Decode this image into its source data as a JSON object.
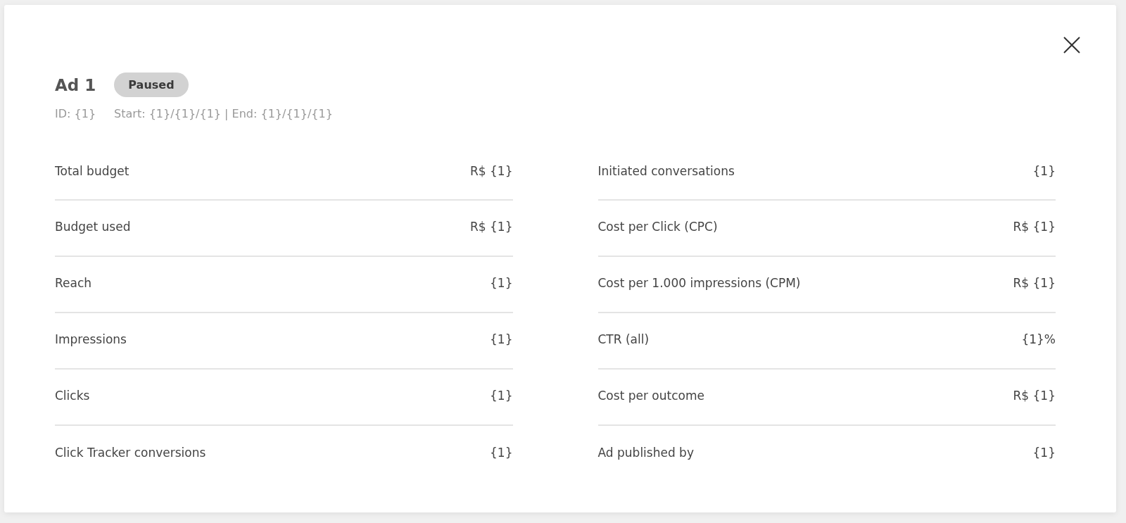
{
  "ad": {
    "title": "Ad 1",
    "status": {
      "label": "Paused",
      "kind": "paused"
    },
    "id": "ID: {1}",
    "dates": "Start: {1}/{1}/{1} | End: {1}/{1}/{1}"
  },
  "columns": [
    [
      {
        "label": "Total budget",
        "value": "R$ {1}"
      },
      {
        "label": "Budget used",
        "value": "R$ {1}"
      },
      {
        "label": "Reach",
        "value": "{1}"
      },
      {
        "label": "Impressions",
        "value": "{1}"
      },
      {
        "label": "Clicks",
        "value": "{1}"
      },
      {
        "label": "Click Tracker conversions",
        "value": "{1}"
      }
    ],
    [
      {
        "label": "Initiated conversations",
        "value": "{1}"
      },
      {
        "label": "Cost per Click (CPC)",
        "value": "R$ {1}"
      },
      {
        "label": "Cost per 1.000 impressions (CPM)",
        "value": "R$ {1}"
      },
      {
        "label": "CTR (all)",
        "value": "{1}%"
      },
      {
        "label": "Cost per outcome",
        "value": "R$ {1}"
      },
      {
        "label": "Ad published by",
        "value": "{1}"
      }
    ]
  ]
}
